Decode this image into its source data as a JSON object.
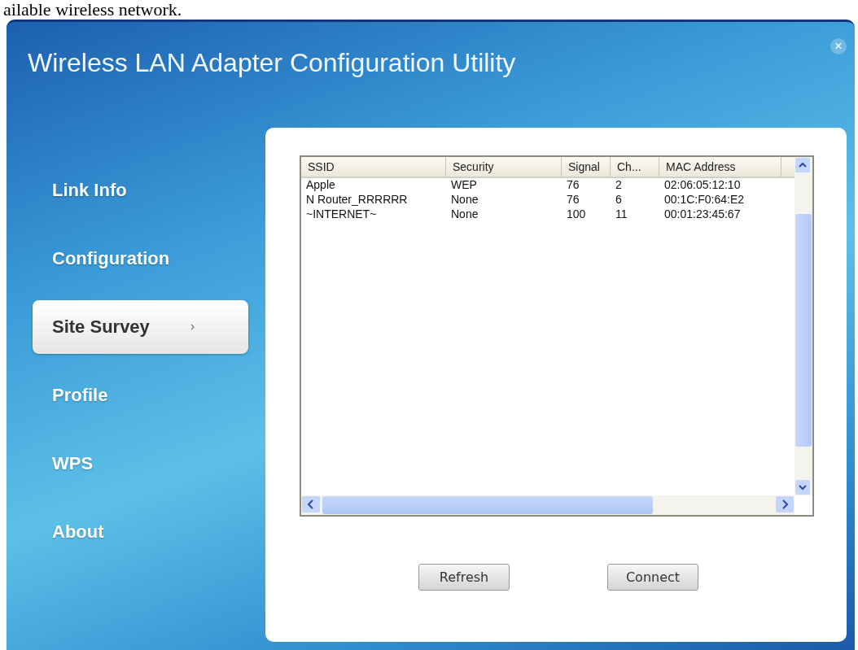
{
  "document_text": "ailable wireless network.",
  "window": {
    "title": "Wireless LAN Adapter Configuration Utility",
    "close": "×"
  },
  "sidebar": {
    "items": [
      {
        "label": "Link Info",
        "selected": false
      },
      {
        "label": "Configuration",
        "selected": false
      },
      {
        "label": "Site Survey",
        "selected": true
      },
      {
        "label": "Profile",
        "selected": false
      },
      {
        "label": "WPS",
        "selected": false
      },
      {
        "label": "About",
        "selected": false
      }
    ]
  },
  "table": {
    "columns": [
      "SSID",
      "Security",
      "Signal",
      "Ch...",
      "MAC Address"
    ],
    "rows": [
      [
        "Apple",
        "WEP",
        "76",
        "2",
        "02:06:05:12:10"
      ],
      [
        "N Router_RRRRRR",
        "None",
        "76",
        "6",
        "00:1C:F0:64:E2"
      ],
      [
        "~INTERNET~",
        "None",
        "100",
        "11",
        "00:01:23:45:67"
      ]
    ]
  },
  "buttons": [
    "Refresh",
    "Connect"
  ]
}
